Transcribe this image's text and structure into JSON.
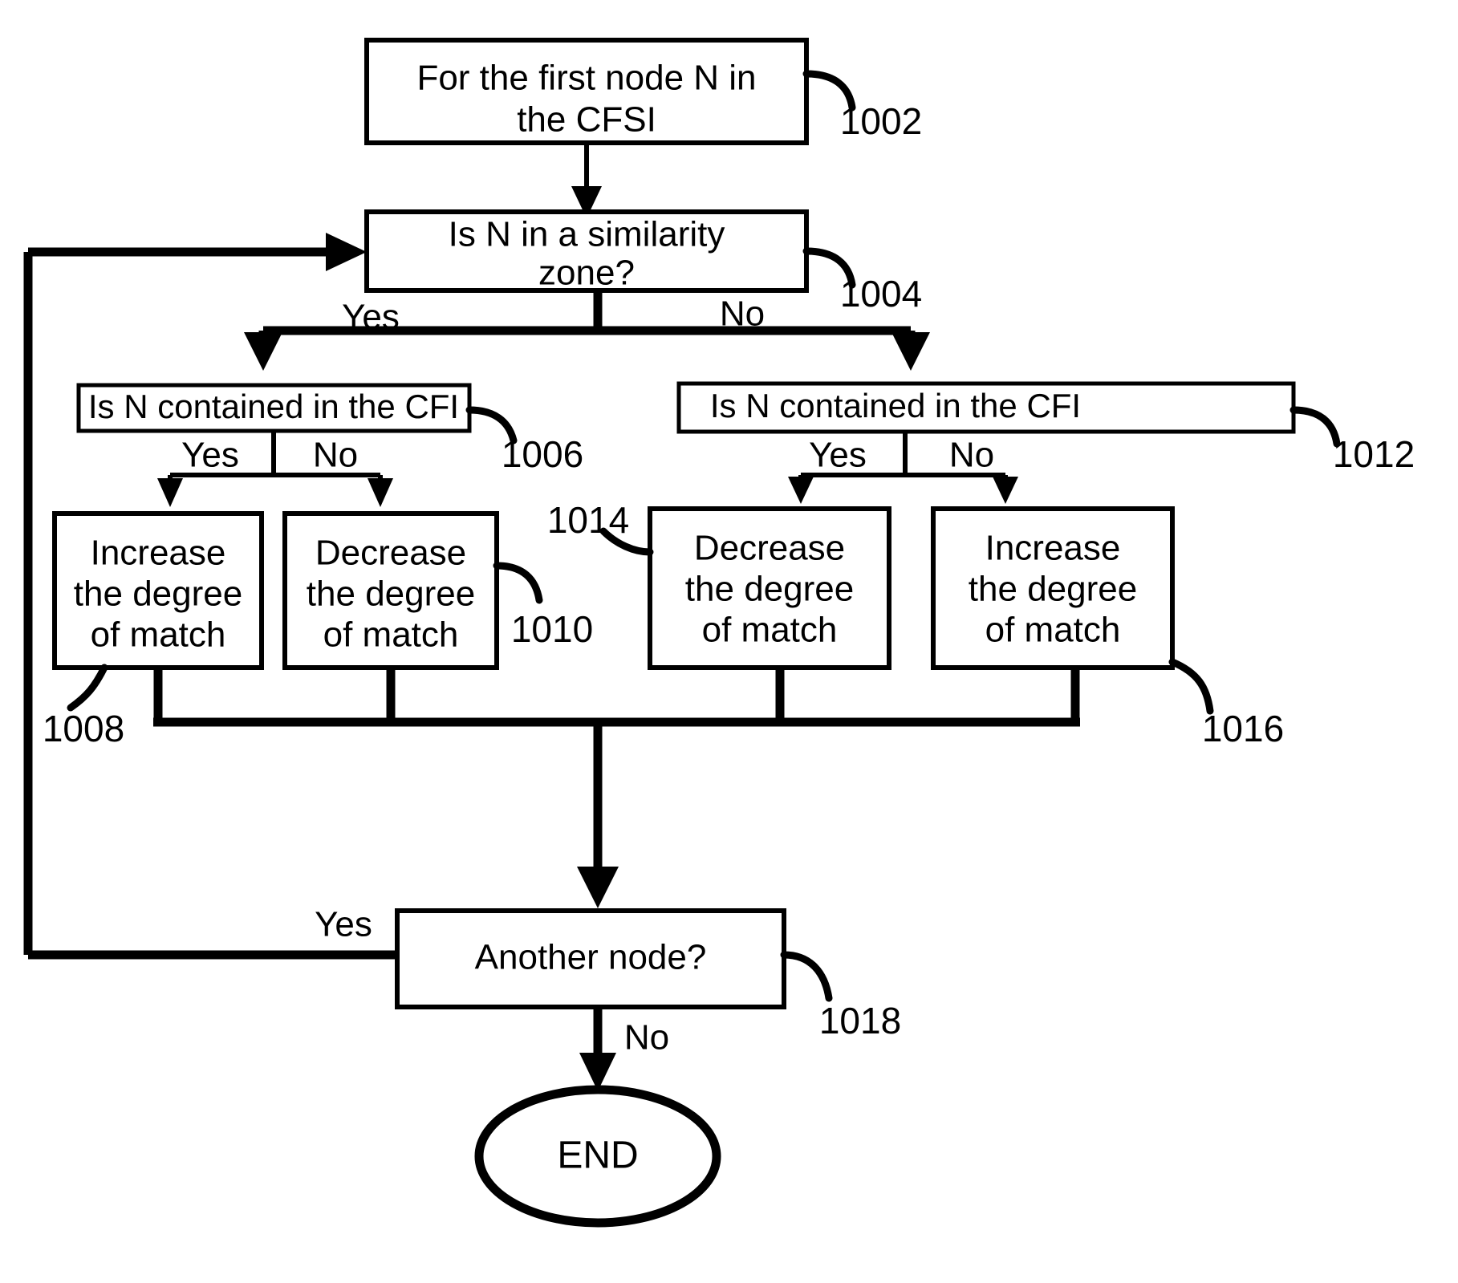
{
  "diagram": {
    "type": "flowchart",
    "title": "",
    "nodes": [
      {
        "ref": "1002",
        "shape": "process",
        "lines": [
          "For the first node N in",
          "the CFSI"
        ]
      },
      {
        "ref": "1004",
        "shape": "decision",
        "lines": [
          "Is N in a similarity",
          "zone?"
        ]
      },
      {
        "ref": "1006",
        "shape": "decision",
        "lines": [
          "Is N contained in the CFI"
        ]
      },
      {
        "ref": "1008",
        "shape": "process",
        "lines": [
          "Increase",
          "the degree",
          "of match"
        ]
      },
      {
        "ref": "1010",
        "shape": "process",
        "lines": [
          "Decrease",
          "the degree",
          "of match"
        ]
      },
      {
        "ref": "1012",
        "shape": "decision",
        "lines": [
          "Is N contained in the CFI"
        ]
      },
      {
        "ref": "1014",
        "shape": "process",
        "lines": [
          "Decrease",
          "the degree",
          "of match"
        ]
      },
      {
        "ref": "1016",
        "shape": "process",
        "lines": [
          "Increase",
          "the degree",
          "of match"
        ]
      },
      {
        "ref": "1018",
        "shape": "decision",
        "lines": [
          "Another node?"
        ]
      },
      {
        "ref": "",
        "shape": "terminator",
        "lines": [
          "END"
        ]
      }
    ],
    "branch_labels": {
      "n1004_yes": "Yes",
      "n1004_no": "No",
      "n1006_yes": "Yes",
      "n1006_no": "No",
      "n1012_yes": "Yes",
      "n1012_no": "No",
      "n1018_yes": "Yes",
      "n1018_no": "No"
    },
    "ref_numbers": {
      "r1002": "1002",
      "r1004": "1004",
      "r1006": "1006",
      "r1008": "1008",
      "r1010": "1010",
      "r1012": "1012",
      "r1014": "1014",
      "r1016": "1016",
      "r1018": "1018"
    },
    "text": {
      "n1002_l1": "For the first node N in",
      "n1002_l2": "the CFSI",
      "n1004_l1": "Is N in a similarity",
      "n1004_l2": "zone?",
      "n1006_l1": "Is N contained in the CFI",
      "n1008_l1": "Increase",
      "n1008_l2": "the degree",
      "n1008_l3": "of match",
      "n1010_l1": "Decrease",
      "n1010_l2": "the degree",
      "n1010_l3": "of match",
      "n1012_l1": "Is N contained in the CFI",
      "n1014_l1": "Decrease",
      "n1014_l2": "the degree",
      "n1014_l3": "of match",
      "n1016_l1": "Increase",
      "n1016_l2": "the degree",
      "n1016_l3": "of match",
      "n1018_l1": "Another node?",
      "end_label": "END"
    },
    "colors": {
      "stroke": "#000000",
      "fill": "#ffffff",
      "text": "#000000"
    }
  }
}
